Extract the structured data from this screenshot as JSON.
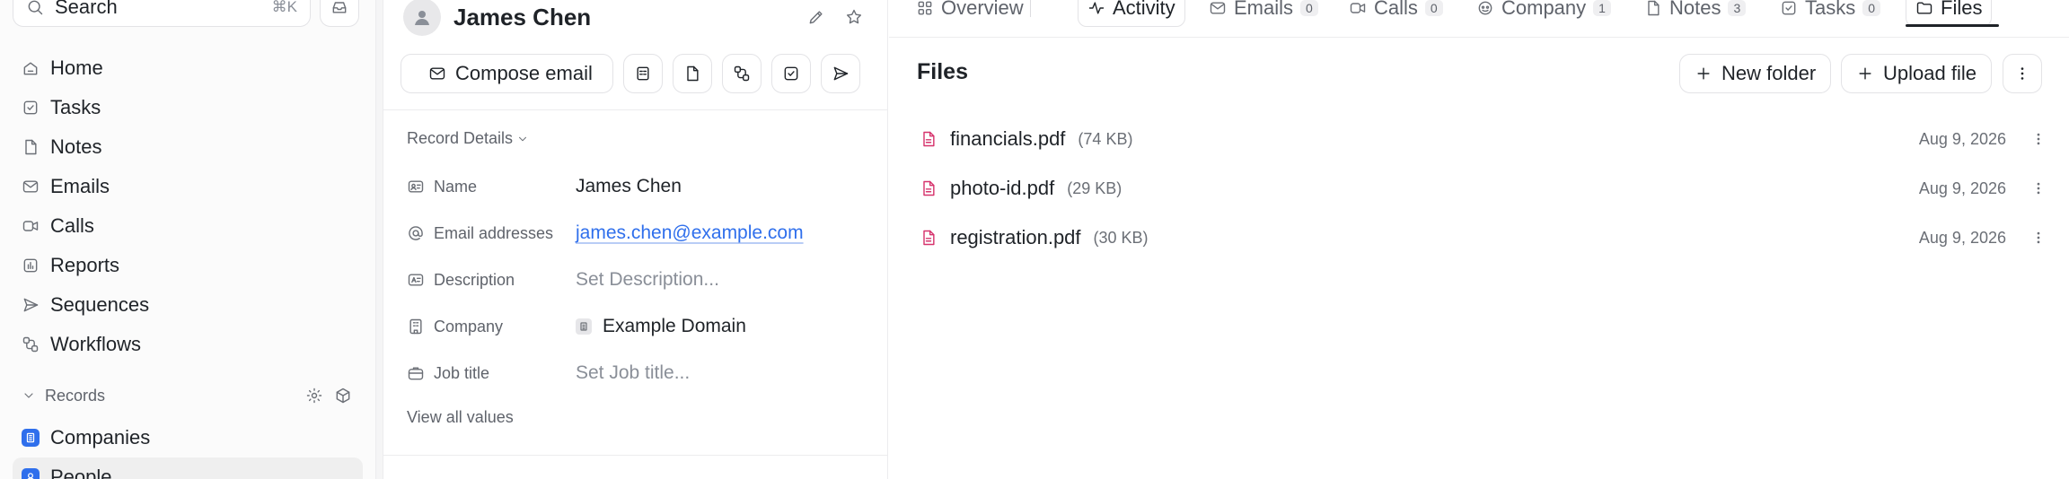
{
  "sidebar": {
    "search": {
      "label": "Search",
      "shortcut": "⌘K"
    },
    "nav": [
      {
        "label": "Home",
        "icon": "home-icon"
      },
      {
        "label": "Tasks",
        "icon": "checkbox-icon"
      },
      {
        "label": "Notes",
        "icon": "note-icon"
      },
      {
        "label": "Emails",
        "icon": "mail-icon"
      },
      {
        "label": "Calls",
        "icon": "video-icon"
      },
      {
        "label": "Reports",
        "icon": "chart-icon"
      },
      {
        "label": "Sequences",
        "icon": "send-icon"
      },
      {
        "label": "Workflows",
        "icon": "workflow-icon"
      }
    ],
    "records_section": {
      "label": "Records"
    },
    "records": [
      {
        "label": "Companies",
        "icon": "building-icon"
      },
      {
        "label": "People",
        "icon": "person-icon"
      }
    ]
  },
  "record": {
    "title": "James Chen",
    "compose_label": "Compose email",
    "details_label": "Record Details",
    "fields": [
      {
        "label": "Name",
        "value": "James Chen",
        "kind": "text"
      },
      {
        "label": "Email addresses",
        "value": "james.chen@example.com",
        "kind": "link"
      },
      {
        "label": "Description",
        "value": "Set Description...",
        "kind": "placeholder"
      },
      {
        "label": "Company",
        "value": "Example Domain",
        "kind": "company"
      },
      {
        "label": "Job title",
        "value": "Set Job title...",
        "kind": "placeholder"
      }
    ],
    "view_all_label": "View all values"
  },
  "tabs": [
    {
      "label": "Overview",
      "icon": "grid-icon"
    },
    {
      "label": "Activity",
      "icon": "activity-icon"
    },
    {
      "label": "Emails",
      "count": "0",
      "icon": "mail-icon"
    },
    {
      "label": "Calls",
      "count": "0",
      "icon": "video-icon"
    },
    {
      "label": "Company",
      "count": "1",
      "icon": "company-icon"
    },
    {
      "label": "Notes",
      "count": "3",
      "icon": "note-icon"
    },
    {
      "label": "Tasks",
      "count": "0",
      "icon": "checkbox-icon"
    },
    {
      "label": "Files",
      "icon": "folder-icon"
    }
  ],
  "active_tab": "Files",
  "files": {
    "title": "Files",
    "new_folder_label": "New folder",
    "upload_label": "Upload file",
    "items": [
      {
        "name": "financials.pdf",
        "size": "(74 KB)",
        "date": "Aug 9, 2026"
      },
      {
        "name": "photo-id.pdf",
        "size": "(29 KB)",
        "date": "Aug 9, 2026"
      },
      {
        "name": "registration.pdf",
        "size": "(30 KB)",
        "date": "Aug 9, 2026"
      }
    ]
  },
  "colors": {
    "accent": "#2f6fec",
    "pdf_icon": "#d6336c",
    "text": "#1f2328",
    "muted": "#5f636b"
  }
}
